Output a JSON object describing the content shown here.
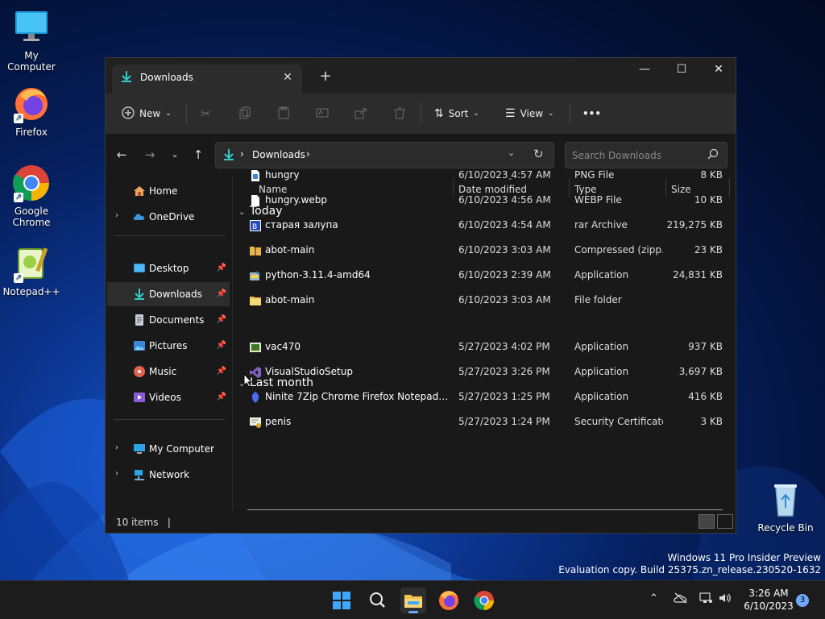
{
  "desktop": {
    "icons": [
      {
        "label": "My Computer",
        "icon": "monitor-icon"
      },
      {
        "label": "Firefox",
        "icon": "firefox-icon"
      },
      {
        "label": "Google Chrome",
        "icon": "chrome-icon"
      },
      {
        "label": "Notepad++",
        "icon": "notepadpp-icon"
      },
      {
        "label": "Recycle Bin",
        "icon": "recycle-bin-icon"
      }
    ],
    "watermark": {
      "line1": "Windows 11 Pro Insider Preview",
      "line2": "Evaluation copy. Build 25375.zn_release.230520-1632"
    }
  },
  "window": {
    "tab_title": "Downloads",
    "tab_close": "✕",
    "new_tab": "+",
    "controls": {
      "minimize": "—",
      "maximize": "☐",
      "close": "✕"
    },
    "toolbar": {
      "new_label": "New",
      "sort_label": "Sort",
      "view_label": "View",
      "more_label": "•••"
    },
    "address": {
      "segments": [
        "Downloads"
      ],
      "sep": "›"
    },
    "search": {
      "placeholder": "Search Downloads"
    },
    "sidebar": {
      "items": [
        {
          "label": "Home",
          "icon": "home-icon"
        },
        {
          "label": "OneDrive",
          "icon": "onedrive-icon"
        },
        {
          "label": "Desktop",
          "icon": "desktop-folder-icon"
        },
        {
          "label": "Downloads",
          "icon": "download-icon"
        },
        {
          "label": "Documents",
          "icon": "documents-icon"
        },
        {
          "label": "Pictures",
          "icon": "pictures-icon"
        },
        {
          "label": "Music",
          "icon": "music-icon"
        },
        {
          "label": "Videos",
          "icon": "videos-icon"
        },
        {
          "label": "My Computer",
          "icon": "computer-icon"
        },
        {
          "label": "Network",
          "icon": "network-icon"
        }
      ]
    },
    "columns": {
      "name": "Name",
      "date": "Date modified",
      "type": "Type",
      "size": "Size"
    },
    "groups": [
      {
        "label": "Today",
        "files": [
          {
            "name": "hungry",
            "date": "6/10/2023 4:57 AM",
            "type": "PNG File",
            "size": "8 KB",
            "icon": "png-file-icon"
          },
          {
            "name": "hungry.webp",
            "date": "6/10/2023 4:56 AM",
            "type": "WEBP File",
            "size": "10 KB",
            "icon": "file-icon"
          },
          {
            "name": "старая залупа",
            "date": "6/10/2023 4:54 AM",
            "type": "rar Archive",
            "size": "219,275 KB",
            "icon": "rar-archive-icon"
          },
          {
            "name": "abot-main",
            "date": "6/10/2023 3:03 AM",
            "type": "Compressed (zipp...",
            "size": "23 KB",
            "icon": "zip-folder-icon"
          },
          {
            "name": "python-3.11.4-amd64",
            "date": "6/10/2023 2:39 AM",
            "type": "Application",
            "size": "24,831 KB",
            "icon": "installer-icon"
          },
          {
            "name": "abot-main",
            "date": "6/10/2023 3:03 AM",
            "type": "File folder",
            "size": "",
            "icon": "folder-icon"
          }
        ]
      },
      {
        "label": "Last month",
        "files": [
          {
            "name": "vac470",
            "date": "5/27/2023 4:02 PM",
            "type": "Application",
            "size": "937 KB",
            "icon": "app-icon"
          },
          {
            "name": "VisualStudioSetup",
            "date": "5/27/2023 3:26 PM",
            "type": "Application",
            "size": "3,697 KB",
            "icon": "visual-studio-icon"
          },
          {
            "name": "Ninite 7Zip Chrome Firefox Notepad Inst...",
            "date": "5/27/2023 1:25 PM",
            "type": "Application",
            "size": "416 KB",
            "icon": "ninite-icon"
          },
          {
            "name": "penis",
            "date": "5/27/2023 1:24 PM",
            "type": "Security Certificate",
            "size": "3 KB",
            "icon": "certificate-icon"
          }
        ]
      }
    ],
    "status": {
      "count": "10 items"
    }
  },
  "taskbar": {
    "time": "3:26 AM",
    "date": "6/10/2023",
    "notification_count": "3"
  }
}
